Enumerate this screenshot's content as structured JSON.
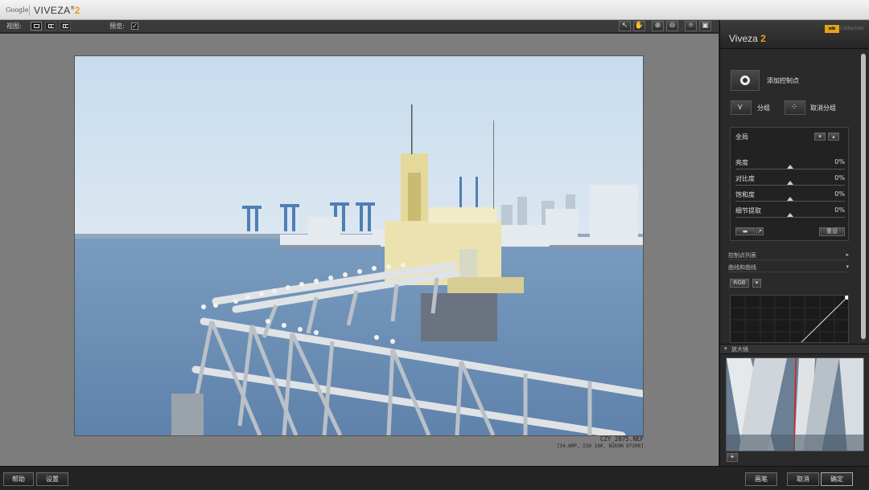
{
  "titlebar": {
    "google": "Google",
    "brand": "VIVEZA",
    "reg": "®",
    "version": "2"
  },
  "toolbar": {
    "view_label": "视图:",
    "preview_label": "预览:",
    "preview_checked": "✓"
  },
  "panel": {
    "title": "Viveza",
    "version": "2",
    "nik_logo": "nik",
    "collection_label": "Collection",
    "add_control_point": "添加控制点",
    "group": "分组",
    "ungroup": "取消分组",
    "global_label": "全局",
    "sliders": [
      {
        "label": "亮度",
        "value": "0%"
      },
      {
        "label": "对比度",
        "value": "0%"
      },
      {
        "label": "饱和度",
        "value": "0%"
      },
      {
        "label": "细节提取",
        "value": "0%"
      }
    ],
    "reset_label": "重设",
    "control_point_list": "控制点列表",
    "levels_curves": "曲线和曲线",
    "channel_select": "RGB",
    "loupe_label": "放大镜"
  },
  "fileinfo": {
    "name": "CZY_2075.NEF",
    "meta": "[34.6MP, ISO 100, NIKON D7200]"
  },
  "bottom": {
    "help": "帮助",
    "settings": "设置",
    "brush": "画笔",
    "cancel": "取消",
    "ok": "确定"
  }
}
